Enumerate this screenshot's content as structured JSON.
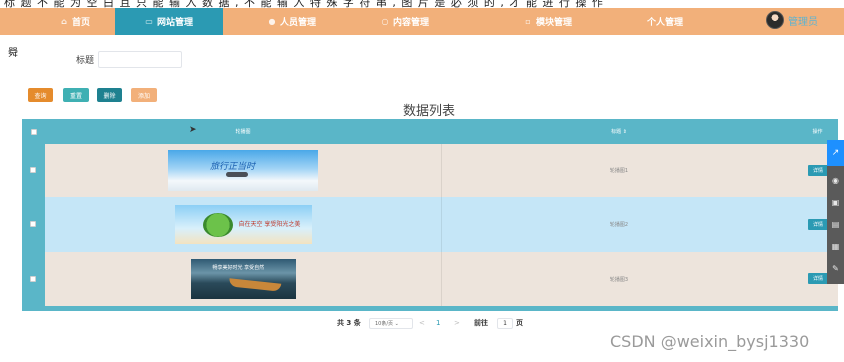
{
  "top_cut_text": "标 题 不 能 为 空 白 且 只 能 输 入 数 据 , 不 能 输 入 特 殊 字 符 串 , 图 片 是 必 须 的 , 才 能 进 行 操 作",
  "nav": {
    "items": [
      {
        "label": "首页",
        "icon": "home-icon"
      },
      {
        "label": "网站管理",
        "icon": "monitor-icon",
        "active": true
      },
      {
        "label": "人员管理",
        "icon": "user-icon"
      },
      {
        "label": "内容管理",
        "icon": "search-icon"
      },
      {
        "label": "模块管理",
        "icon": "grid-icon"
      },
      {
        "label": "个人管理",
        "icon": "person-icon"
      }
    ],
    "username": "管理员"
  },
  "page_glyph": "䑝",
  "filter": {
    "label": "标题",
    "value": "",
    "placeholder": ""
  },
  "buttons": {
    "search": "查询",
    "reset": "重置",
    "delete": "删除",
    "add": "添加"
  },
  "table": {
    "title": "数据列表",
    "columns": {
      "image": "轮播图",
      "title": "标题 ⇕",
      "action": "操作"
    },
    "rows": [
      {
        "title": "轮播图1",
        "action": "详情",
        "banner_text": "旅行正当时"
      },
      {
        "title": "轮播图2",
        "action": "详情",
        "banner_text": "自在天空 享受阳光之美"
      },
      {
        "title": "轮播图3",
        "action": "详情",
        "banner_text": "畅享美好时光 享受自然"
      }
    ]
  },
  "pagination": {
    "total": "共 3 条",
    "page_size": "10条/页 ⌄",
    "prev": "<",
    "current": "1",
    "next": ">",
    "goto": "前往",
    "goto_value": "1",
    "unit": "页"
  },
  "watermark": "CSDN @weixin_bysj1330",
  "colors": {
    "nav": "#f2b07a",
    "active": "#2b9ab3",
    "table_head": "#5ab6c8",
    "row_odd": "#ede4dc",
    "row_even": "#c5e6f7"
  }
}
